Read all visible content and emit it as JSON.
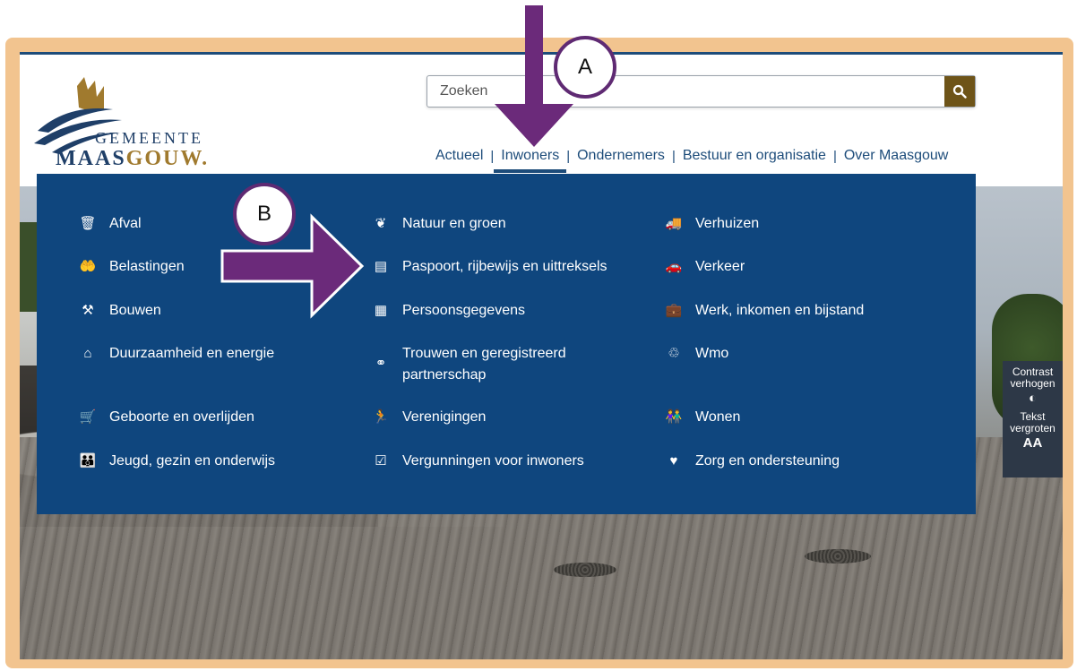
{
  "header": {
    "logo": {
      "line1": "GEMEENTE",
      "line2_part1": "MAAS",
      "line2_part2": "GOUW."
    },
    "search": {
      "placeholder": "Zoeken",
      "button_icon": "search-icon"
    },
    "nav": [
      {
        "label": "Actueel",
        "active": false
      },
      {
        "label": "Inwoners",
        "active": true
      },
      {
        "label": "Ondernemers",
        "active": false
      },
      {
        "label": "Bestuur en organisatie",
        "active": false
      },
      {
        "label": "Over Maasgouw",
        "active": false
      }
    ],
    "nav_separator": "|"
  },
  "menu": {
    "columns": [
      [
        {
          "label": "Afval",
          "icon": "trash-bin-icon"
        },
        {
          "label": "Belastingen",
          "icon": "money-hand-icon"
        },
        {
          "label": "Bouwen",
          "icon": "tools-icon"
        },
        {
          "label": "Duurzaamheid en energie",
          "icon": "eco-house-icon"
        },
        {
          "label": "Geboorte en overlijden",
          "icon": "baby-carriage-icon"
        },
        {
          "label": "Jeugd, gezin en onderwijs",
          "icon": "family-icon"
        }
      ],
      [
        {
          "label": "Natuur en groen",
          "icon": "nature-icon"
        },
        {
          "label": "Paspoort, rijbewijs en uittreksels",
          "icon": "id-card-icon"
        },
        {
          "label": "Persoonsgegevens",
          "icon": "document-icon"
        },
        {
          "label": "Trouwen en geregistreerd partnerschap",
          "icon": "rings-icon"
        },
        {
          "label": "Verenigingen",
          "icon": "person-activity-icon"
        },
        {
          "label": "Vergunningen voor inwoners",
          "icon": "permit-icon"
        }
      ],
      [
        {
          "label": "Verhuizen",
          "icon": "moving-truck-icon"
        },
        {
          "label": "Verkeer",
          "icon": "traffic-icon"
        },
        {
          "label": "Werk, inkomen en bijstand",
          "icon": "briefcase-icon"
        },
        {
          "label": "Wmo",
          "icon": "care-hand-icon"
        },
        {
          "label": "Wonen",
          "icon": "people-icon"
        },
        {
          "label": "Zorg en ondersteuning",
          "icon": "heart-icon"
        }
      ]
    ]
  },
  "accessibility": {
    "contrast_label": "Contrast verhogen",
    "contrast_symbol": "◐",
    "text_label": "Tekst vergroten",
    "text_symbol": "AA"
  },
  "annotations": {
    "a_label": "A",
    "b_label": "B",
    "arrow_color": "#6b2a7a"
  },
  "colors": {
    "menu_bg": "#0f467e",
    "frame": "#f2c48f",
    "nav_text": "#1d4c7a",
    "search_button": "#6e5418"
  }
}
